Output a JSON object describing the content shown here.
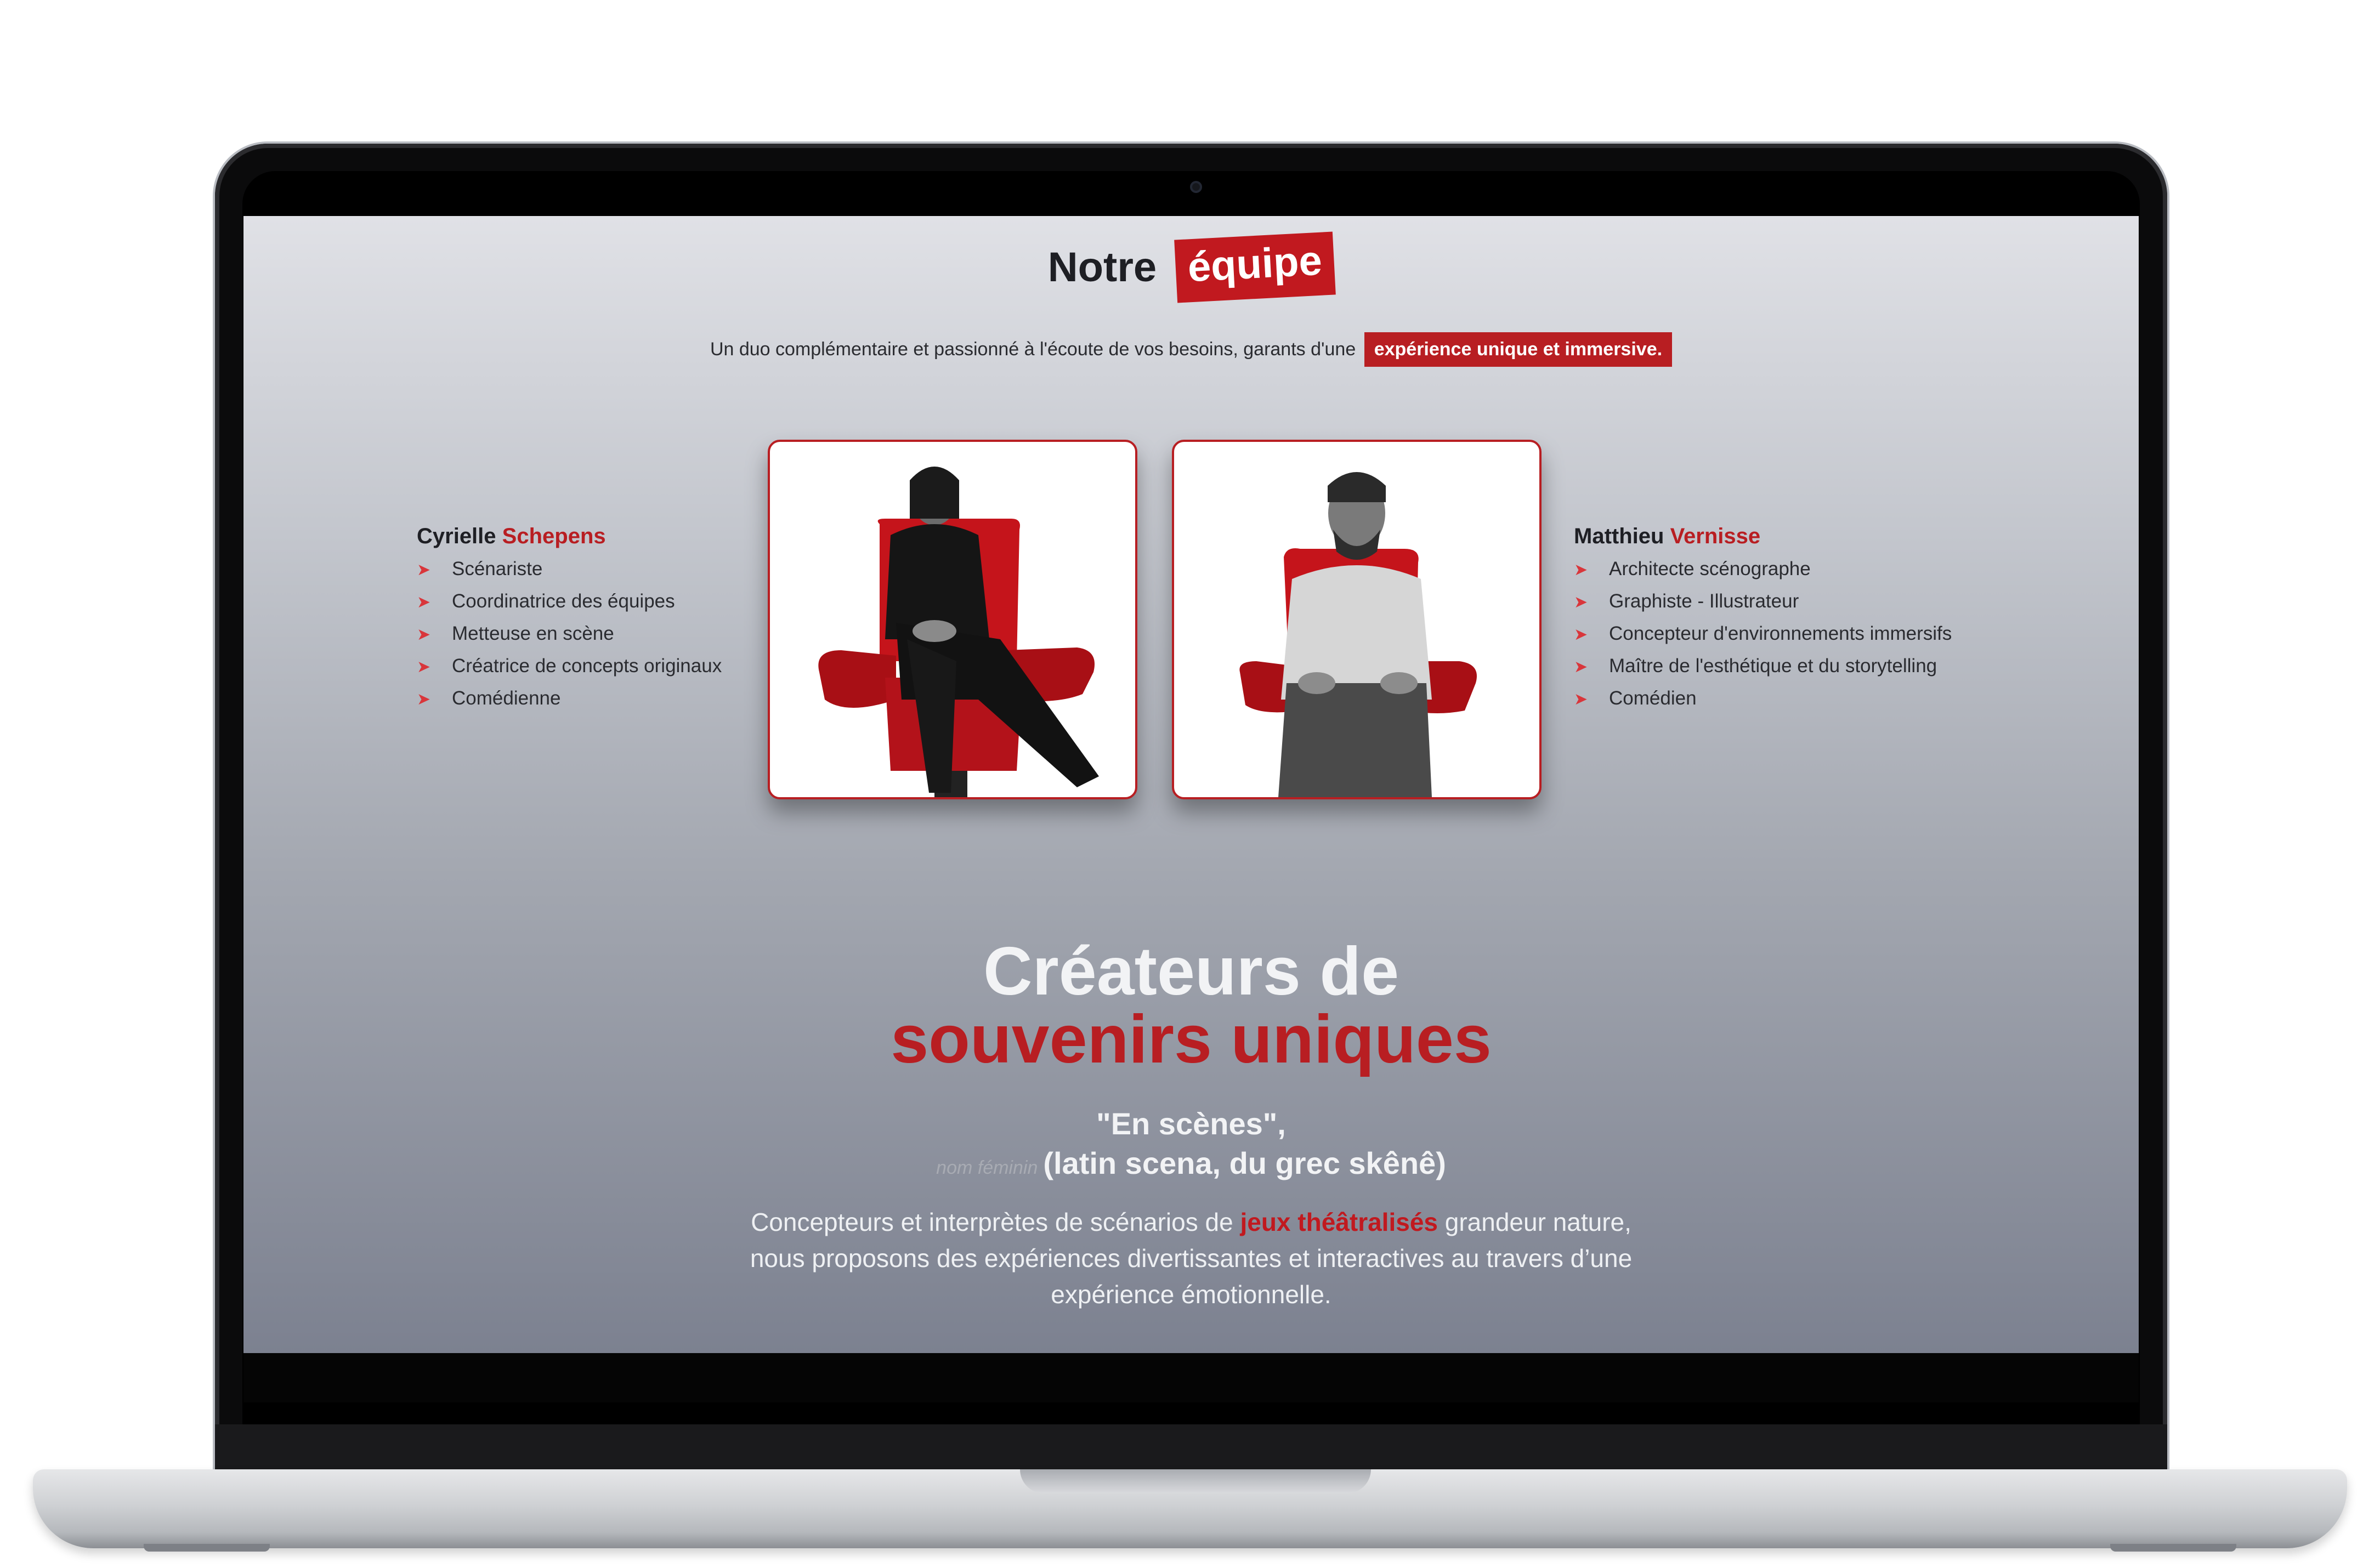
{
  "team": {
    "title_word": "Notre",
    "title_badge": "équipe",
    "intro_text": "Un duo complémentaire et passionné à l'écoute de vos besoins, garants d'une",
    "intro_highlight": "expérience unique et immersive.",
    "members": [
      {
        "first_name": "Cyrielle",
        "last_name": "Schepens",
        "roles": [
          "Scénariste",
          "Coordinatrice des équipes",
          "Metteuse en scène",
          "Créatrice de concepts originaux",
          "Comédienne"
        ]
      },
      {
        "first_name": "Matthieu",
        "last_name": "Vernisse",
        "roles": [
          "Architecte scénographe",
          "Graphiste - Illustrateur",
          "Concepteur d'environnements immersifs",
          "Maître de l'esthétique et du storytelling",
          "Comédien"
        ]
      }
    ]
  },
  "hero": {
    "line1": "Créateurs de",
    "line2": "souvenirs uniques",
    "quote_line1": "\"En scènes\",",
    "quote_small": "nom féminin",
    "quote_line2": "(latin scena, du grec skênê)",
    "desc_part1": "Concepteurs et interprètes de scénarios de",
    "desc_highlight": "jeux théâtralisés",
    "desc_part2": "grandeur nature, nous proposons des expériences divertissantes et interactives au travers d’une expérience émotionnelle."
  },
  "icons": {
    "bullet": "arrow-icon",
    "camera": "camera-icon"
  },
  "colors": {
    "accent": "#b81e22",
    "text_dark": "#1e1f24",
    "text_light": "#f2f3f5"
  }
}
